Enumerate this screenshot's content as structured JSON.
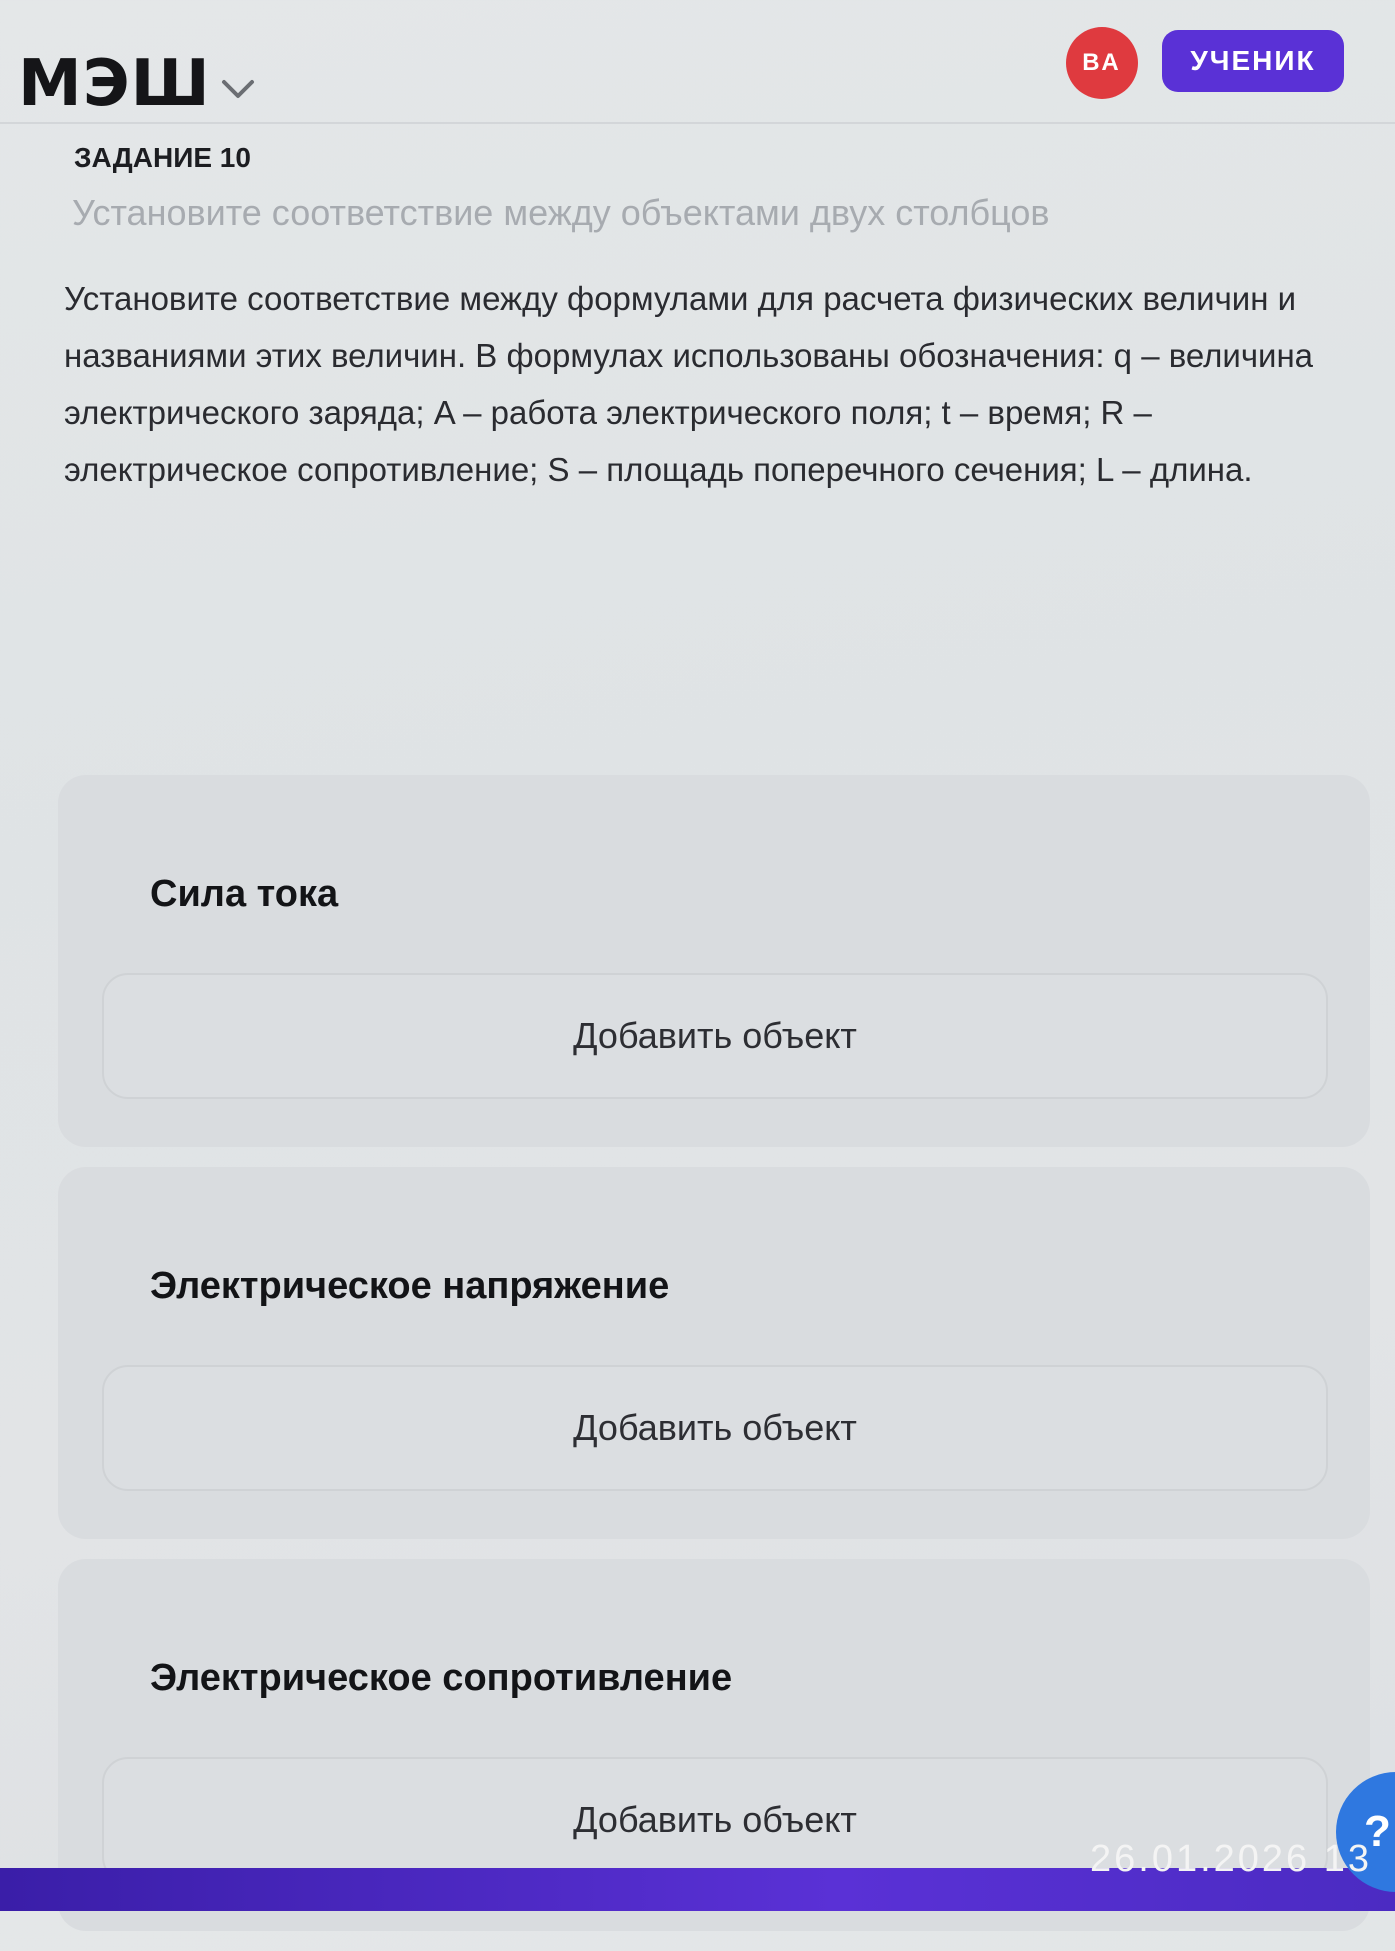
{
  "header": {
    "logo": "МЭШ",
    "avatar_initials": "ВА",
    "role_badge": "УЧЕНИК"
  },
  "task": {
    "number_label": "ЗАДАНИЕ 10",
    "subtitle": "Установите соответствие между объектами двух столбцов",
    "text": "Установите соответствие между формулами для расчета физических величин и названиями этих величин. В формулах использованы обозначения: q – величина электрического заряда; A – работа электрического поля; t – время; R – электрическое сопротивление; S – площадь поперечного сечения; L – длина."
  },
  "cards": [
    {
      "title": "Сила тока",
      "add_label": "Добавить объект"
    },
    {
      "title": "Электрическое напряжение",
      "add_label": "Добавить объект"
    },
    {
      "title": "Электрическое сопротивление",
      "add_label": "Добавить объект"
    }
  ],
  "help_button": {
    "label": "?"
  },
  "photo_stamp": "26.01.2026 13"
}
